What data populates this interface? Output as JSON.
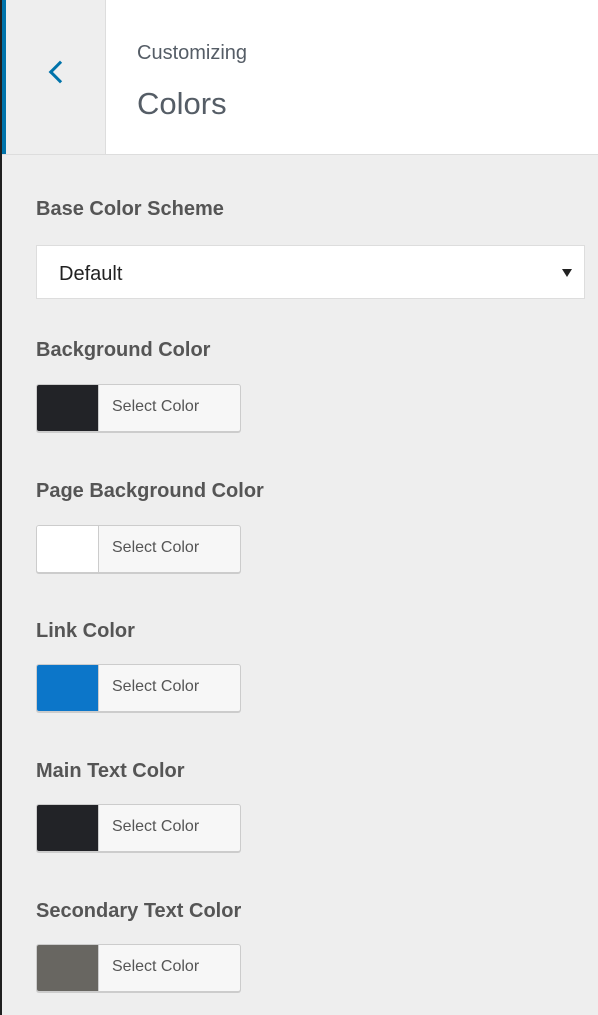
{
  "header": {
    "pretitle": "Customizing",
    "title": "Colors"
  },
  "base_scheme": {
    "label": "Base Color Scheme",
    "value": "Default"
  },
  "controls": [
    {
      "label": "Background Color",
      "button": "Select Color",
      "color": "#222327"
    },
    {
      "label": "Page Background Color",
      "button": "Select Color",
      "color": "#ffffff"
    },
    {
      "label": "Link Color",
      "button": "Select Color",
      "color": "#0c76c9"
    },
    {
      "label": "Main Text Color",
      "button": "Select Color",
      "color": "#222327"
    },
    {
      "label": "Secondary Text Color",
      "button": "Select Color",
      "color": "#686661"
    }
  ]
}
